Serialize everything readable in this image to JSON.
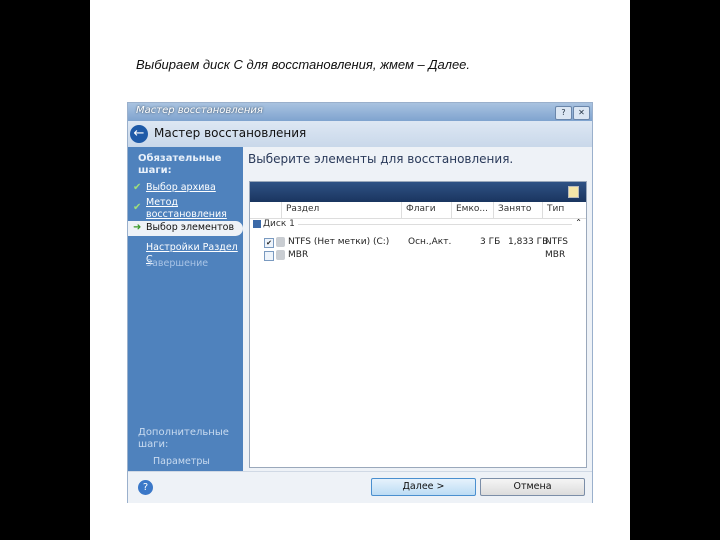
{
  "caption": "Выбираем диск С для восстановления, жмем – Далее.",
  "window": {
    "title": "Мастер восстановления",
    "header_title": "Мастер восстановления"
  },
  "sidebar": {
    "required_heading": "Обязательные шаги:",
    "items": [
      {
        "label": "Выбор архива",
        "state": "done"
      },
      {
        "label": "Метод восстановления",
        "state": "done"
      },
      {
        "label": "Выбор элементов",
        "state": "current"
      },
      {
        "label": "Настройки Раздел С",
        "state": "link"
      },
      {
        "label": "Завершение",
        "state": "disabled"
      }
    ],
    "optional_heading": "Дополнительные шаги:",
    "optional_items": [
      {
        "label": "Параметры"
      }
    ]
  },
  "main": {
    "title": "Выберите элементы для восстановления.",
    "columns": [
      "Раздел",
      "Флаги",
      "Емко...",
      "Занято",
      "Тип"
    ],
    "disk_label": "Диск 1",
    "rows": [
      {
        "checked": true,
        "partition": "NTFS (Нет метки) (C:)",
        "flags": "Осн.,Акт.",
        "capacity": "3 ГБ",
        "used": "1,833 ГБ",
        "type": "NTFS"
      },
      {
        "checked": false,
        "partition": "MBR",
        "flags": "",
        "capacity": "",
        "used": "",
        "type": "MBR"
      }
    ]
  },
  "buttons": {
    "next": "Далее >",
    "cancel": "Отмена"
  }
}
